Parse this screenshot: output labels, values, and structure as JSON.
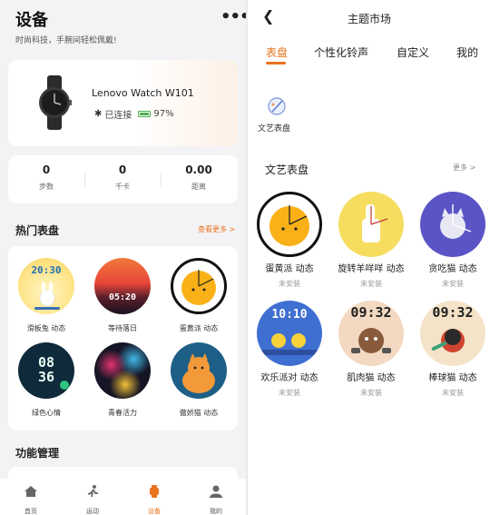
{
  "left": {
    "title": "设备",
    "subtitle": "时尚科技，手腕间轻松佩戴!",
    "more_icon": "more-dots-icon",
    "device": {
      "name": "Lenovo Watch W101",
      "status": "已连接",
      "battery": "97%"
    },
    "stats": [
      {
        "value": "0",
        "label": "步数"
      },
      {
        "value": "0",
        "label": "千卡"
      },
      {
        "value": "0.00",
        "label": "距离"
      }
    ],
    "popular_title": "热门表盘",
    "see_more": "查看更多 >",
    "faces": [
      {
        "name": "滑板兔 动态",
        "time": "20:30"
      },
      {
        "name": "等待落日",
        "time": "05:20"
      },
      {
        "name": "蛋黄派 动态",
        "time": ""
      },
      {
        "name": "绿色心情",
        "time": "08 36"
      },
      {
        "name": "青春活力",
        "time": ""
      },
      {
        "name": "傲娇猫 动态",
        "time": ""
      }
    ],
    "function_title": "功能管理",
    "tabs": [
      {
        "label": "首页",
        "icon": "home-icon"
      },
      {
        "label": "运动",
        "icon": "run-icon"
      },
      {
        "label": "设备",
        "icon": "watch-icon"
      },
      {
        "label": "我的",
        "icon": "person-icon"
      }
    ],
    "accent": "#e8731f"
  },
  "right": {
    "title": "主题市场",
    "categories": [
      "表盘",
      "个性化铃声",
      "自定义",
      "我的"
    ],
    "active_category": "表盘",
    "art_label": "文艺表盘",
    "section_title": "文艺表盘",
    "more": "更多 >",
    "faces": [
      {
        "name": "蛋黄派 动态",
        "status": "未安装",
        "time": ""
      },
      {
        "name": "旋转羊咩咩 动态",
        "status": "未安装",
        "time": ""
      },
      {
        "name": "贪吃猫 动态",
        "status": "未安装",
        "time": ""
      },
      {
        "name": "欢乐派对 动态",
        "status": "未安装",
        "time": "10:10"
      },
      {
        "name": "肌肉猫 动态",
        "status": "未安装",
        "time": "09:32"
      },
      {
        "name": "棒球猫 动态",
        "status": "未安装",
        "time": "09:32"
      }
    ]
  }
}
